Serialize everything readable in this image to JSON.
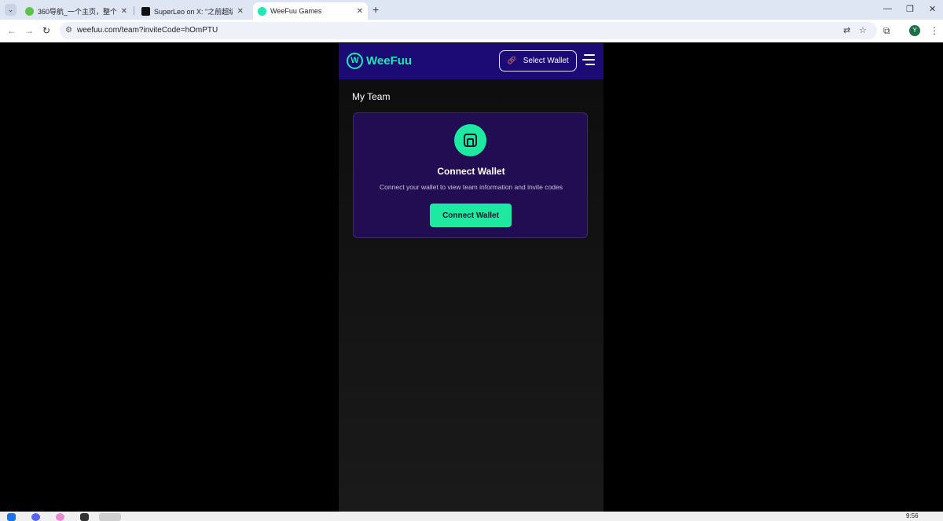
{
  "browser": {
    "tabs": [
      {
        "label": "360导航_一个主页，整个世界",
        "active": false
      },
      {
        "label": "SuperLeo on X: \"之前超级熊",
        "active": false
      },
      {
        "label": "WeeFuu Games",
        "active": true
      }
    ],
    "url": "weefuu.com/team?inviteCode=hOmPTU",
    "profile_initial": "Y"
  },
  "header": {
    "logo_text": "WeeFuu",
    "select_wallet_label": "Select Wallet"
  },
  "main": {
    "page_title": "My Team",
    "card": {
      "title": "Connect Wallet",
      "description": "Connect your wallet to view team information and invite codes",
      "button_label": "Connect Wallet"
    }
  },
  "taskbar": {
    "time": "9:56"
  },
  "colors": {
    "header_bg": "#1c0b74",
    "accent": "#1de9a0",
    "card_bg": "#230d52"
  }
}
